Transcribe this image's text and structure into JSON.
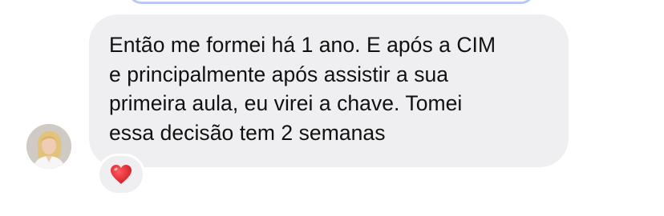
{
  "conversation": {
    "incoming_message": {
      "lines": [
        "Então me formei há 1 ano. E após a CIM",
        "e principalmente após assistir a sua",
        "primeira aula, eu virei a chave. Tomei",
        "essa decisão tem 2 semanas"
      ],
      "reaction": "heart-icon"
    },
    "sender": {
      "avatar": "avatar-photo"
    }
  },
  "colors": {
    "bubble_background": "#efeff1",
    "text": "#111111",
    "previous_bubble_border": "#b9c8f5",
    "reaction_heart": "#e3242b"
  }
}
